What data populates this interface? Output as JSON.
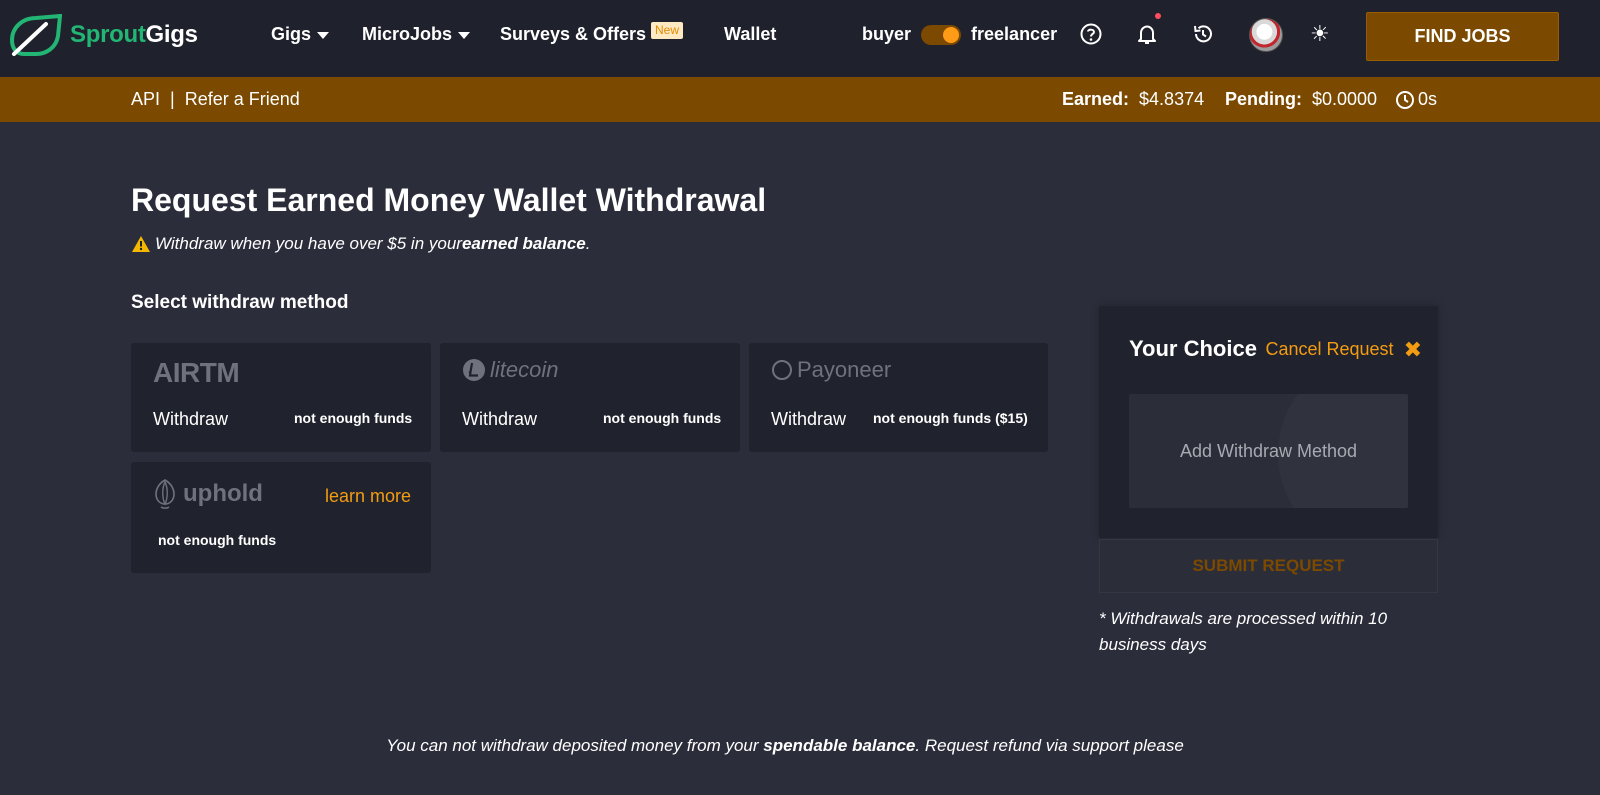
{
  "brand": {
    "part1": "Sprout",
    "part2": "Gigs"
  },
  "nav": {
    "gigs": "Gigs",
    "microjobs": "MicroJobs",
    "surveys": "Surveys & Offers",
    "new_badge": "New",
    "wallet": "Wallet"
  },
  "role": {
    "buyer": "buyer",
    "freelancer": "freelancer"
  },
  "find_jobs": "FIND JOBS",
  "subbar": {
    "api": "API",
    "separator": "|",
    "refer": "Refer a Friend",
    "earned_label": "Earned:",
    "earned_value": "$4.8374",
    "pending_label": "Pending:",
    "pending_value": "$0.0000",
    "timer": "0s"
  },
  "page": {
    "title": "Request Earned Money Wallet Withdrawal",
    "warning_pre": "Withdraw when you have over $5 in your ",
    "warning_bold": "earned balance",
    "warning_post": ".",
    "section_title": "Select withdraw method"
  },
  "methods": [
    {
      "logo": "AIRTM",
      "withdraw": "Withdraw",
      "status": "not enough funds"
    },
    {
      "logo": "litecoin",
      "withdraw": "Withdraw",
      "status": "not enough funds"
    },
    {
      "logo": "Payoneer",
      "withdraw": "Withdraw",
      "status": "not enough funds ($15)"
    },
    {
      "logo": "uphold",
      "learn_more": "learn more",
      "status": "not enough funds"
    }
  ],
  "choice": {
    "title": "Your Choice",
    "cancel": "Cancel Request",
    "cancel_icon": "✖",
    "add_method": "Add Withdraw Method",
    "submit": "SUBMIT REQUEST",
    "note": "* Withdrawals are processed within 10 business days"
  },
  "footer": {
    "pre": "You can not withdraw deposited money from your ",
    "bold": "spendable balance",
    "post": ". Request refund via support please"
  },
  "colors": {
    "background": "#2b2d3a",
    "topbar": "#1f212c",
    "accent": "#7b4900",
    "link_orange": "#f39c12",
    "brand_green": "#22b573"
  }
}
